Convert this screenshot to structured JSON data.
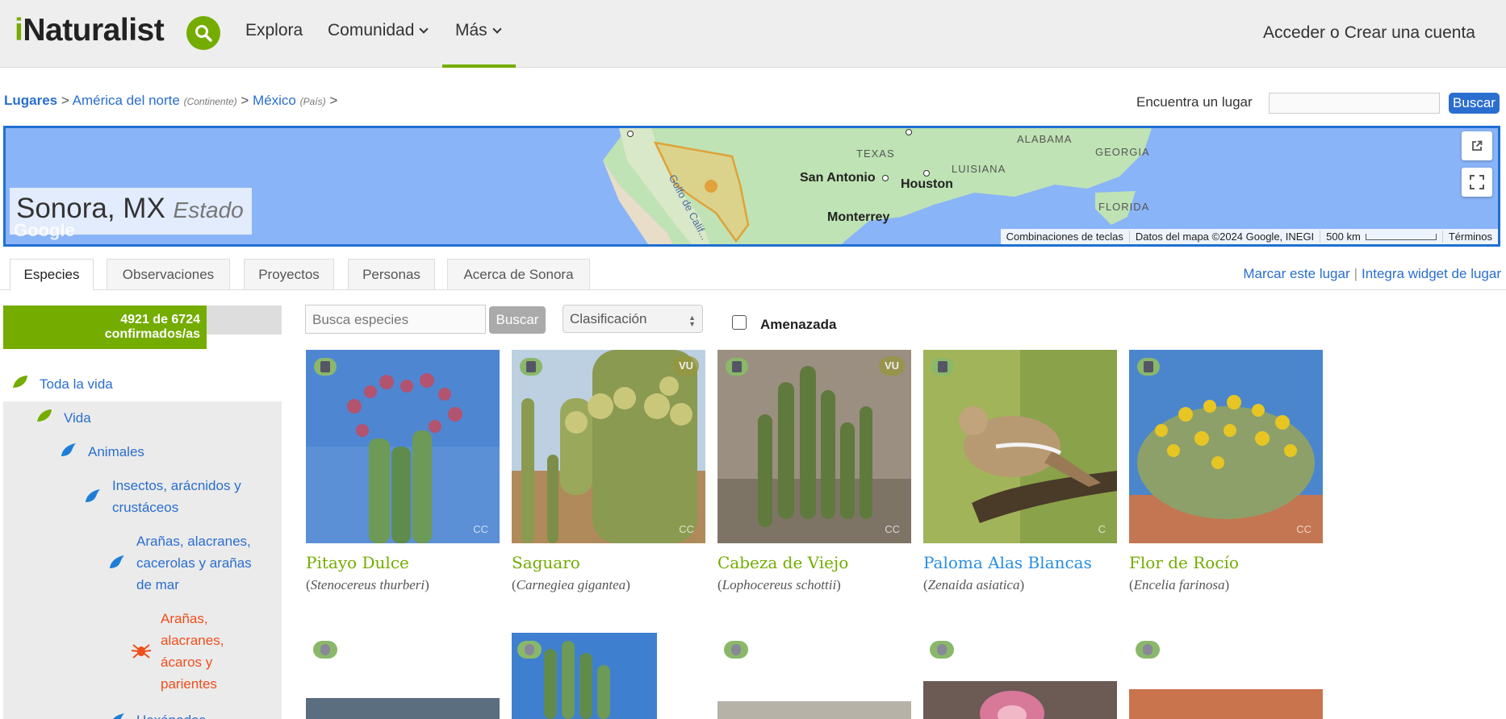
{
  "header": {
    "logo_i": "i",
    "logo_rest": "Naturalist",
    "nav": {
      "explora": "Explora",
      "comunidad": "Comunidad",
      "mas": "Más"
    },
    "login": "Acceder",
    "or": "o",
    "signup": "Crear una cuenta",
    "accent": "#74ac00"
  },
  "breadcrumb": {
    "root": "Lugares",
    "sep": ">",
    "level1": "América del norte",
    "level1_type": "(Continente)",
    "level2": "México",
    "level2_type": "(País)"
  },
  "place_search": {
    "label": "Encuentra un lugar",
    "value": "",
    "button": "Buscar"
  },
  "map": {
    "place_name": "Sonora, MX",
    "place_kind": "Estado",
    "labels": [
      "TEXAS",
      "ALABAMA",
      "GEORGIA",
      "LUISIANA",
      "FLORIDA"
    ],
    "cities": [
      "San Antonio",
      "Houston",
      "Monterrey"
    ],
    "gulf_label": "Golfo de Calif...",
    "google": "Google",
    "footer": {
      "shortcuts": "Combinaciones de teclas",
      "data": "Datos del mapa ©2024 Google, INEGI",
      "scale": "500 km",
      "terms": "Términos"
    }
  },
  "tabs": [
    {
      "label": "Especies",
      "active": true
    },
    {
      "label": "Observaciones",
      "active": false
    },
    {
      "label": "Proyectos",
      "active": false
    },
    {
      "label": "Personas",
      "active": false
    },
    {
      "label": "Acerca de Sonora",
      "active": false
    }
  ],
  "tab_links": {
    "bookmark": "Marcar este lugar",
    "sep": "|",
    "widget": "Integra widget de lugar"
  },
  "sidebar": {
    "stats_line1": "4921 de 6724",
    "stats_line2": "confirmados/as",
    "stats_fraction": 0.732,
    "tree": [
      {
        "label": "Toda la vida",
        "icon": "leaf-icon"
      },
      {
        "label": "Vida",
        "icon": "leaf-icon"
      },
      {
        "label": "Animales",
        "icon": "bird-icon"
      },
      {
        "label": "Insectos, arácnidos y crustáceos",
        "line1": "Insectos, arácnidos y",
        "line2": "crustáceos",
        "icon": "bird-icon"
      },
      {
        "label": "Arañas, alacranes, cacerolas y arañas de mar",
        "line1": "Arañas, alacranes,",
        "line2": "cacerolas y arañas",
        "line3": "de mar",
        "icon": "bird-icon"
      },
      {
        "label": "Arañas, alacranes, ácaros y parientes",
        "line1": "Arañas,",
        "line2": "alacranes,",
        "line3": "ácaros y",
        "line4": "parientes",
        "icon": "spider-icon",
        "selected": true
      },
      {
        "label": "Hexápodos",
        "icon": "bird-icon"
      }
    ]
  },
  "filters": {
    "search_placeholder": "Busca especies",
    "search_button": "Buscar",
    "classification": "Clasificación",
    "threatened_label": "Amenazada",
    "threatened_checked": false
  },
  "species": [
    {
      "common": "Pitayo Dulce",
      "scientific": "Stenocereus thurberi",
      "license": "CC",
      "status": ""
    },
    {
      "common": "Saguaro",
      "scientific": "Carnegiea gigantea",
      "license": "CC",
      "status": "VU"
    },
    {
      "common": "Cabeza de Viejo",
      "scientific": "Lophocereus schottii",
      "license": "CC",
      "status": "VU"
    },
    {
      "common": "Paloma Alas Blancas",
      "scientific": "Zenaida asiatica",
      "license": "C",
      "status": ""
    },
    {
      "common": "Flor de Rocío",
      "scientific": "Encelia farinosa",
      "license": "CC",
      "status": ""
    }
  ]
}
